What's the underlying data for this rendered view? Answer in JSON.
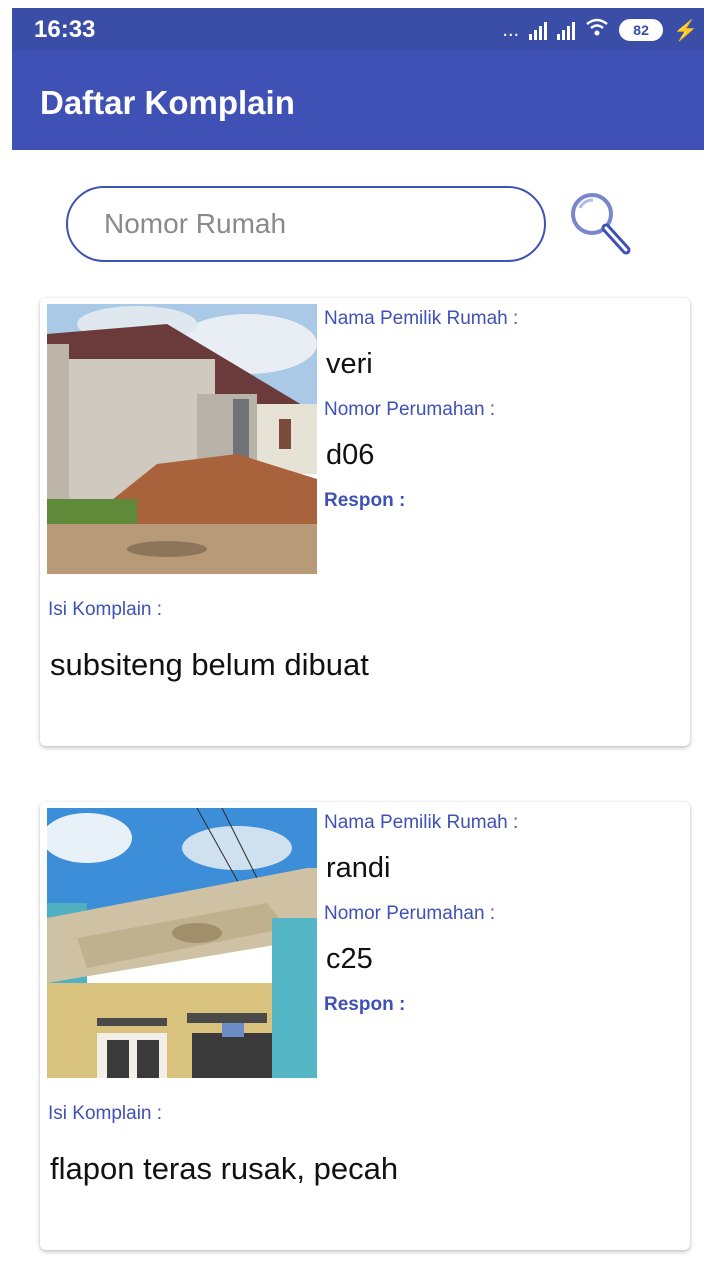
{
  "status_bar": {
    "time": "16:33",
    "dots": "...",
    "battery": "82",
    "icons": [
      "signal-icon",
      "signal-icon",
      "wifi-icon",
      "battery-icon",
      "charging-icon"
    ]
  },
  "app_bar": {
    "title": "Daftar Komplain"
  },
  "search": {
    "placeholder": "Nomor Rumah",
    "value": "",
    "icon": "search-icon"
  },
  "colors": {
    "primary": "#3f51b5",
    "status_bar": "#3a4ea8",
    "label": "#3f51b5",
    "text": "#111111"
  },
  "complaints": [
    {
      "owner_label": "Nama Pemilik Rumah :",
      "owner": "veri",
      "number_label": "Nomor Perumahan :",
      "number": "d06",
      "respon_label": "Respon :",
      "respon": "",
      "isi_label": "Isi Komplain :",
      "isi": "subsiteng belum dibuat",
      "photo": "house-photo"
    },
    {
      "owner_label": "Nama Pemilik Rumah :",
      "owner": "randi",
      "number_label": "Nomor Perumahan :",
      "number": "c25",
      "respon_label": "Respon :",
      "respon": "",
      "isi_label": "Isi Komplain :",
      "isi": "flapon teras rusak, pecah",
      "photo": "house-photo"
    }
  ]
}
